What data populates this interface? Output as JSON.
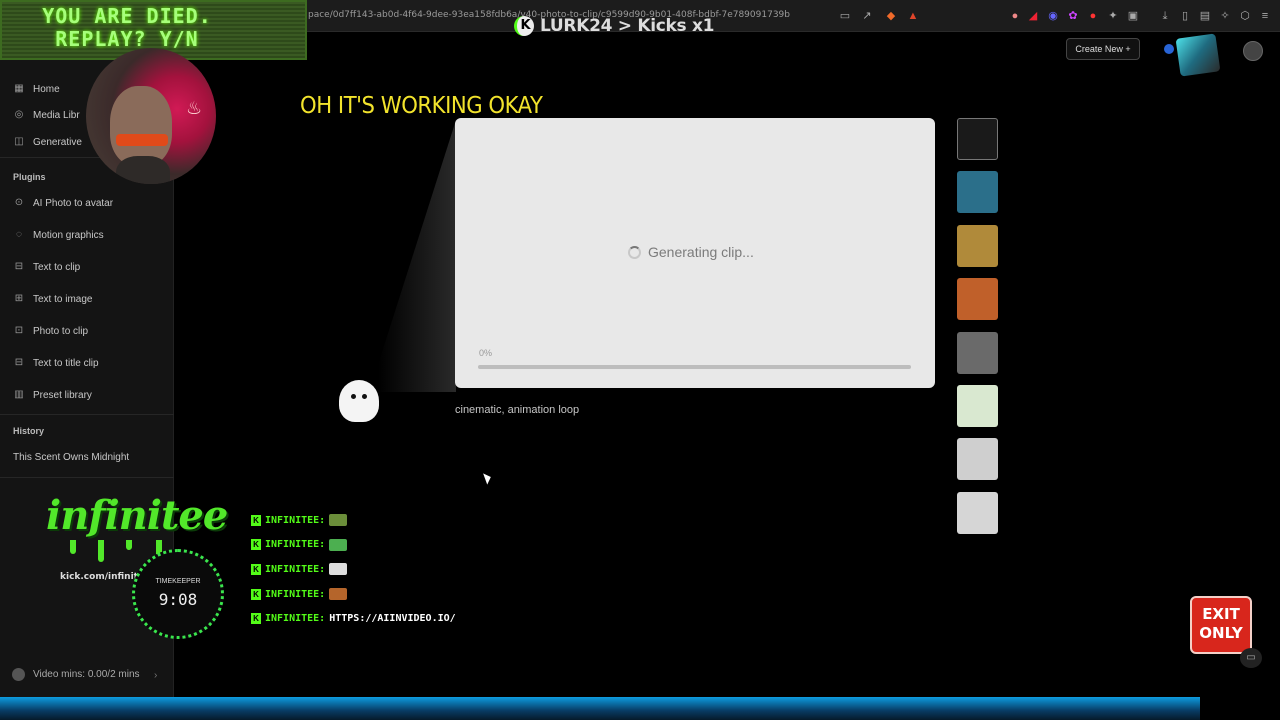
{
  "browser": {
    "url": "pace/0d7ff143-ab0d-4f64-9dee-93ea158fdb6a/v40-photo-to-clip/c9599d90-9b01-408f-bdbf-7e789091739b"
  },
  "overlay": {
    "died_text": "YOU ARE DIED.\nREPLAY? Y/N",
    "kick_banner": "LURK24 > Kicks x1",
    "exit_sign": "EXIT\nONLY",
    "logo_word": "infinitee",
    "logo_url": "kick.com/infinitee",
    "timekeeper_label": "TIMEKEEPER",
    "timekeeper_time": "9:08",
    "chat": [
      {
        "name": "INFINITEE:",
        "emote_color": "#6b8e3a",
        "msg": ""
      },
      {
        "name": "INFINITEE:",
        "emote_color": "#4caf50",
        "msg": ""
      },
      {
        "name": "INFINITEE:",
        "emote_color": "#dddddd",
        "msg": ""
      },
      {
        "name": "INFINITEE:",
        "emote_color": "#b5652b",
        "msg": ""
      },
      {
        "name": "INFINITEE:",
        "emote_color": "",
        "msg": "HTTPS://AIINVIDEO.IO/"
      }
    ]
  },
  "sidebar": {
    "nav": [
      {
        "label": "Home",
        "icon": "grid-icon"
      },
      {
        "label": "Media Libr",
        "icon": "media-icon"
      },
      {
        "label": "Generative",
        "icon": "generative-icon"
      }
    ],
    "plugins_title": "Plugins",
    "plugins": [
      {
        "label": "AI Photo to avatar",
        "icon": "avatar-plugin-icon"
      },
      {
        "label": "Motion graphics",
        "icon": "motion-icon"
      },
      {
        "label": "Text to clip",
        "icon": "text-clip-icon"
      },
      {
        "label": "Text to image",
        "icon": "text-image-icon"
      },
      {
        "label": "Photo to clip",
        "icon": "photo-clip-icon"
      },
      {
        "label": "Text to title clip",
        "icon": "title-clip-icon"
      },
      {
        "label": "Preset library",
        "icon": "library-icon"
      }
    ],
    "history_title": "History",
    "history": [
      "This Scent Owns Midnight"
    ],
    "video_mins": "Video mins: 0.00/2 mins"
  },
  "topbar": {
    "create_new": "Create New +"
  },
  "main": {
    "headline": "OH IT'S WORKING OKAY",
    "status": "Generating clip...",
    "progress_label": "0%",
    "progress_value": 0,
    "prompt": "cinematic, animation loop"
  },
  "thumbnails": [
    {
      "color": "#1a1a1a",
      "selected": true
    },
    {
      "color": "#2b6f8a"
    },
    {
      "color": "#b08a3a"
    },
    {
      "color": "#c0602a"
    },
    {
      "color": "#6a6a6a"
    },
    {
      "color": "#d9e8d0"
    },
    {
      "color": "#cfcfcf"
    },
    {
      "color": "#d6d6d6"
    }
  ],
  "colors": {
    "accent_green": "#53fc18",
    "headline_yellow": "#f2e32c",
    "exit_red": "#d8261c"
  }
}
